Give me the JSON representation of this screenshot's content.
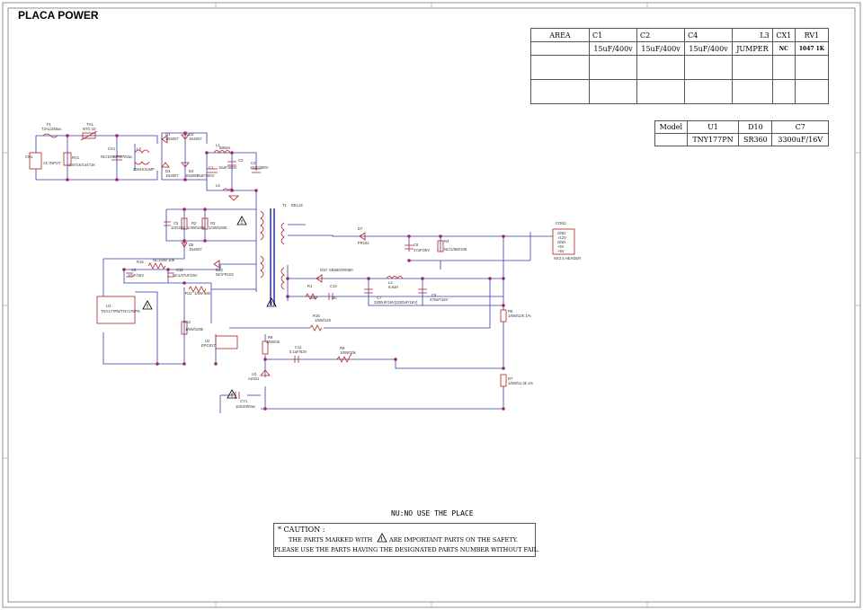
{
  "page_title": "PLACA POWER",
  "area_table": {
    "headers": [
      "AREA",
      "C1",
      "C2",
      "C4",
      "L3",
      "CX1",
      "RV1"
    ],
    "row1": [
      "",
      "15uF/400v",
      "15uF/400v",
      "15uF/400v",
      "JUMPER",
      "NC",
      "1047 1K"
    ]
  },
  "model_table": {
    "headers": [
      "Model",
      "U1",
      "D10",
      "C7"
    ],
    "row1": [
      "",
      "TNY177PN",
      "SR360",
      "3300uF/16V"
    ]
  },
  "notes": {
    "nu": "NU:NO USE THE PLACE",
    "caution_title": "* CAUTION :",
    "caution_line1_a": "THE PARTS MARKED WITH",
    "caution_line1_b": "ARE IMPORTANT PARTS ON THE SAFETY.",
    "caution_line2": "PLEASE USE THE PARTS HAVING THE DESIGNATED PARTS NUMBER WITHOUT FAIL."
  },
  "labels": {
    "f1": "F1",
    "f1v": "T2AL/250ac",
    "th1": "TH1",
    "th1v": "NTC 10",
    "cn1": "CN1",
    "acin": "AC INPUT",
    "rv1": "RV1",
    "rv1v": "10471K/14471K",
    "cx1": "CX1",
    "cx1v": "NC/10.1uF/275Vac",
    "l3": "L3",
    "l3v": "20mH/JUMP",
    "d1": "D1",
    "d1v": "1N4007",
    "d2": "D2",
    "d2v": "1N4007",
    "d3": "D3",
    "d3v": "1N4007",
    "d4": "D4",
    "d4v": "1N4007",
    "l1": "L1",
    "l1v": "680uH",
    "c1": "C1",
    "c1v": "15uF/400V",
    "c2": "C2",
    "c2v": "15uF/400V",
    "c4": "C4",
    "c4v": "15uF/400V",
    "l6": "L6",
    "t1": "T1",
    "t1v": "EEL19",
    "c5": "C5",
    "c5v": "102/1KV",
    "r2": "R2",
    "r2v": "1/4W/100K",
    "r3": "R3",
    "r3v": "1/4W/100K",
    "d5": "D5",
    "d5v": "1N4007",
    "r15": "R15",
    "r15v": "NC1/6W 10K",
    "c6": "C6",
    "c6v": "10uF/16V",
    "c12": "C12",
    "c12v": "NC1/47uF/25V",
    "d13": "D13",
    "d13v": "NC/FR102",
    "r11": "R11",
    "r11v": "1/6W 680",
    "u1": "U1",
    "u1v": "TNY177PN/TNY178PN",
    "r13": "R13",
    "r13v": "1/6W/100k",
    "u2": "U2",
    "u2v": "EPC817",
    "d7": "D7",
    "d7v": "FR102",
    "c8": "C8",
    "c8v": "47uF/25V",
    "r4": "R4",
    "r4v": "NC/1/6W/10K",
    "d10": "D10",
    "d10v": "SB560/SR360",
    "r1": "R1",
    "r1v": "NC",
    "c14": "C14",
    "c14v": "NC",
    "l2": "L2",
    "l2v": "6.8uH",
    "c7": "C7",
    "c7v": "3300uF/16V(2200uF/16V)",
    "c9": "C9",
    "c9v": "470uF/16V",
    "r16": "R16",
    "r16v": "1/6W/120",
    "r8": "R8",
    "r8v": "1/6W/1k",
    "c11": "C11",
    "c11v": "0.1uF/63V",
    "r9": "R9",
    "r9v": "1/6W/10k",
    "u3": "U3",
    "u3v": "AZ431",
    "cy1": "CY1",
    "cy1v": "102/400Vac",
    "r6": "R6",
    "r6v": "1/6W/12K 1%",
    "r7": "R7",
    "r7v": "1/6W/11.3k 1%",
    "con2": "CON2",
    "con2v": "NX2.5 HEADER",
    "pins": [
      "GND",
      "+12V",
      "GND",
      "+5V",
      "+5V"
    ]
  },
  "colors": {
    "wire": "#3a3ab0",
    "junction": "#a0266a",
    "part": "#b02020",
    "frame": "#777777"
  }
}
